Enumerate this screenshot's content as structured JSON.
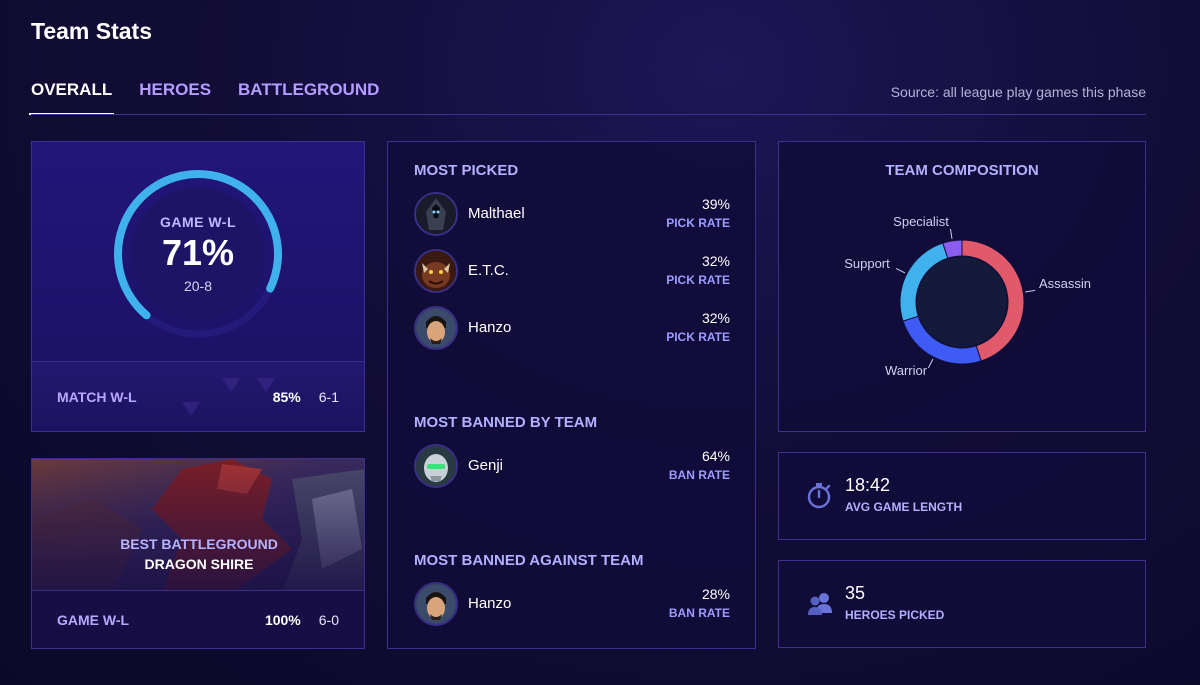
{
  "page": {
    "title": "Team Stats",
    "source": "Source: all league play games this phase"
  },
  "tabs": [
    {
      "label": "OVERALL",
      "active": true
    },
    {
      "label": "HEROES",
      "active": false
    },
    {
      "label": "BATTLEGROUND",
      "active": false
    }
  ],
  "game_wl": {
    "label": "GAME W-L",
    "percent_text": "71%",
    "record": "20-8",
    "win_fraction": 0.71,
    "footer": {
      "label": "MATCH W-L",
      "percent": "85%",
      "record": "6-1"
    }
  },
  "battleground": {
    "label": "BEST BATTLEGROUND",
    "name": "DRAGON SHIRE",
    "footer": {
      "label": "GAME W-L",
      "percent": "100%",
      "record": "6-0"
    }
  },
  "most_picked": {
    "title": "MOST PICKED",
    "heroes": [
      {
        "name": "Malthael",
        "percent": "39%",
        "rate_label": "PICK RATE",
        "avatar": "malthael-avatar"
      },
      {
        "name": "E.T.C.",
        "percent": "32%",
        "rate_label": "PICK RATE",
        "avatar": "etc-avatar"
      },
      {
        "name": "Hanzo",
        "percent": "32%",
        "rate_label": "PICK RATE",
        "avatar": "hanzo-avatar"
      }
    ]
  },
  "most_banned_by": {
    "title": "MOST BANNED BY TEAM",
    "heroes": [
      {
        "name": "Genji",
        "percent": "64%",
        "rate_label": "BAN RATE",
        "avatar": "genji-avatar"
      }
    ]
  },
  "most_banned_against": {
    "title": "MOST BANNED AGAINST TEAM",
    "heroes": [
      {
        "name": "Hanzo",
        "percent": "28%",
        "rate_label": "BAN RATE",
        "avatar": "hanzo-avatar"
      }
    ]
  },
  "composition": {
    "title": "TEAM COMPOSITION",
    "segments": [
      {
        "name": "Assassin",
        "fraction": 0.45,
        "color": "#e05a6c"
      },
      {
        "name": "Warrior",
        "fraction": 0.25,
        "color": "#3e5cf5"
      },
      {
        "name": "Support",
        "fraction": 0.25,
        "color": "#3fb2ee"
      },
      {
        "name": "Specialist",
        "fraction": 0.05,
        "color": "#8a5cf0"
      }
    ]
  },
  "stats": {
    "avg_game_length": {
      "value": "18:42",
      "label": "AVG GAME LENGTH",
      "icon": "stopwatch-icon"
    },
    "heroes_picked": {
      "value": "35",
      "label": "HEROES PICKED",
      "icon": "users-icon"
    }
  },
  "colors": {
    "accent": "#b59cff",
    "gauge": "#3fb2ee",
    "panel_border": "#3d2e8f"
  }
}
